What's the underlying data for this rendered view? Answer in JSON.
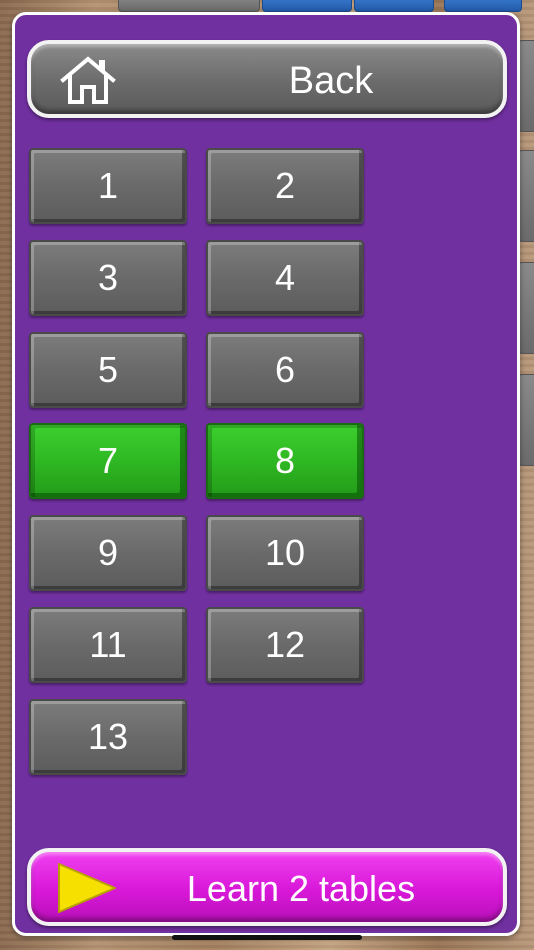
{
  "header": {
    "back_label": "Back",
    "home_icon": "home-icon"
  },
  "tables": [
    {
      "label": "1",
      "selected": false
    },
    {
      "label": "2",
      "selected": false
    },
    {
      "label": "3",
      "selected": false
    },
    {
      "label": "4",
      "selected": false
    },
    {
      "label": "5",
      "selected": false
    },
    {
      "label": "6",
      "selected": false
    },
    {
      "label": "7",
      "selected": true
    },
    {
      "label": "8",
      "selected": true
    },
    {
      "label": "9",
      "selected": false
    },
    {
      "label": "10",
      "selected": false
    },
    {
      "label": "11",
      "selected": false
    },
    {
      "label": "12",
      "selected": false
    },
    {
      "label": "13",
      "selected": false
    }
  ],
  "footer": {
    "learn_label": "Learn 2 tables",
    "play_icon": "play-icon"
  },
  "colors": {
    "panel": "#7030a0",
    "selected": "#2fb823",
    "unselected": "#6a6a6a",
    "learn_button": "#d818d8",
    "play_icon": "#f5e000"
  }
}
